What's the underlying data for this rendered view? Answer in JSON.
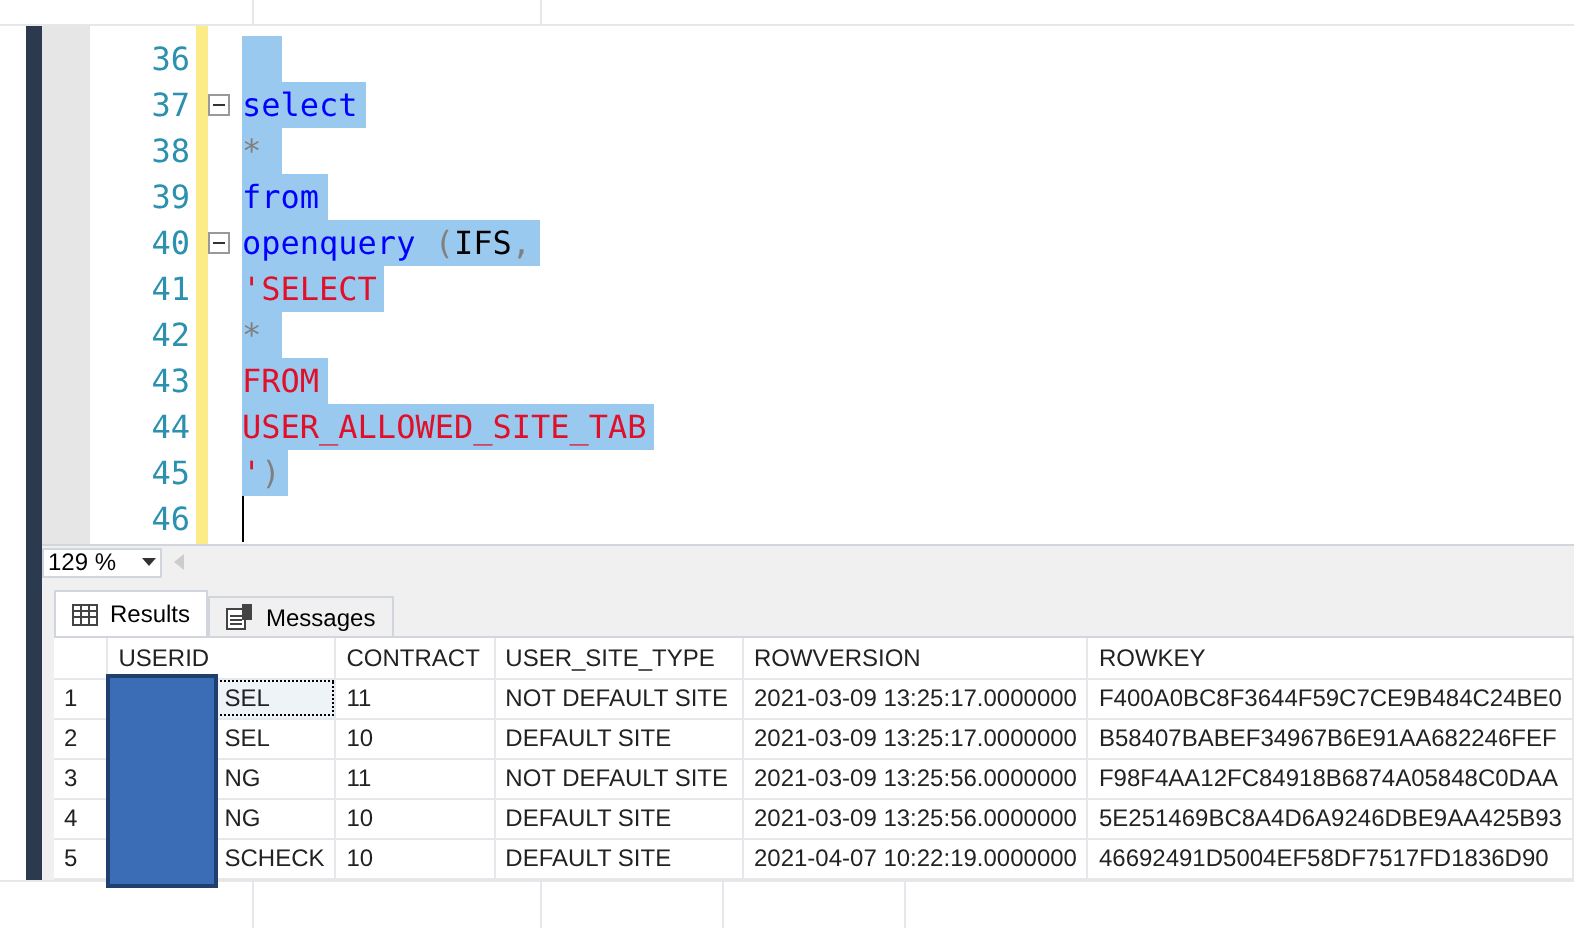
{
  "editor": {
    "lines": [
      {
        "number": "36",
        "fold": false,
        "selected": true
      },
      {
        "number": "37",
        "fold": true,
        "selected": true,
        "tokens": [
          {
            "kind": "keyword",
            "text": "select"
          }
        ]
      },
      {
        "number": "38",
        "fold": false,
        "selected": true,
        "tokens": [
          {
            "kind": "operator",
            "text": "*"
          }
        ]
      },
      {
        "number": "39",
        "fold": false,
        "selected": true,
        "tokens": [
          {
            "kind": "keyword",
            "text": "from"
          }
        ]
      },
      {
        "number": "40",
        "fold": true,
        "selected": true,
        "tokens": [
          {
            "kind": "keyword",
            "text": "openquery"
          },
          {
            "kind": "operator",
            "text": " ("
          },
          {
            "kind": "plain",
            "text": "IFS"
          },
          {
            "kind": "operator",
            "text": ","
          }
        ]
      },
      {
        "number": "41",
        "fold": false,
        "selected": true,
        "tokens": [
          {
            "kind": "string",
            "text": "'SELECT"
          }
        ]
      },
      {
        "number": "42",
        "fold": false,
        "selected": true,
        "tokens": [
          {
            "kind": "operator",
            "text": "*"
          }
        ]
      },
      {
        "number": "43",
        "fold": false,
        "selected": true,
        "tokens": [
          {
            "kind": "string",
            "text": "FROM"
          }
        ]
      },
      {
        "number": "44",
        "fold": false,
        "selected": true,
        "tokens": [
          {
            "kind": "string",
            "text": "USER_ALLOWED_SITE_TAB"
          }
        ]
      },
      {
        "number": "45",
        "fold": false,
        "selected": true,
        "tokens": [
          {
            "kind": "string",
            "text": "'"
          },
          {
            "kind": "operator",
            "text": ")"
          }
        ]
      },
      {
        "number": "46",
        "fold": false,
        "selected": false
      }
    ]
  },
  "zoom": {
    "value": "129 %"
  },
  "tabs": [
    {
      "label": "Results",
      "selected": true
    },
    {
      "label": "Messages",
      "selected": false
    }
  ],
  "table": {
    "columns": [
      "USERID",
      "CONTRACT",
      "USER_SITE_TYPE",
      "ROWVERSION",
      "ROWKEY"
    ],
    "rows": [
      {
        "number": "1",
        "focused": true,
        "cells": [
          "SEL",
          "11",
          "NOT DEFAULT SITE",
          "2021-03-09 13:25:17.0000000",
          "F400A0BC8F3644F59C7CE9B484C24BE0"
        ]
      },
      {
        "number": "2",
        "focused": false,
        "cells": [
          "SEL",
          "10",
          "DEFAULT SITE",
          "2021-03-09 13:25:17.0000000",
          "B58407BABEF34967B6E91AA682246FEF"
        ]
      },
      {
        "number": "3",
        "focused": false,
        "cells": [
          "NG",
          "11",
          "NOT DEFAULT SITE",
          "2021-03-09 13:25:56.0000000",
          "F98F4AA12FC84918B6874A05848C0DAA"
        ]
      },
      {
        "number": "4",
        "focused": false,
        "cells": [
          "NG",
          "10",
          "DEFAULT SITE",
          "2021-03-09 13:25:56.0000000",
          "5E251469BC8A4D6A9246DBE9AA425B93"
        ]
      },
      {
        "number": "5",
        "focused": false,
        "cells": [
          "SCHECK",
          "10",
          "DEFAULT SITE",
          "2021-04-07 10:22:19.0000000",
          "46692491D5004EF58DF7517FD1836D90"
        ]
      }
    ]
  }
}
